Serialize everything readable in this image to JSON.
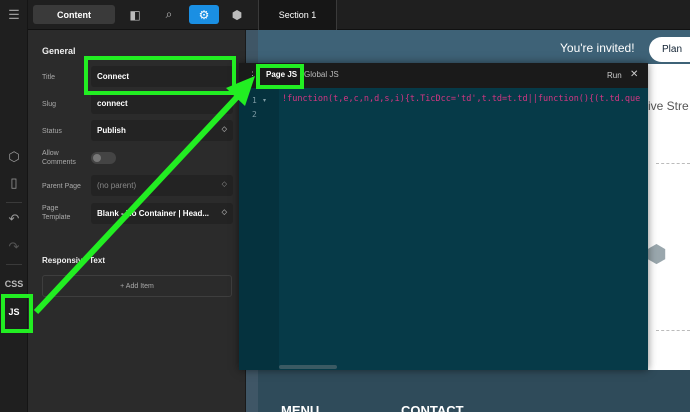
{
  "toolbar": {
    "content_tab": "Content",
    "section_tab": "Section 1"
  },
  "rail": {
    "css_label": "CSS",
    "js_label": "JS"
  },
  "panel": {
    "general_heading": "General",
    "title_label": "Title",
    "title_value": "Connect",
    "slug_label": "Slug",
    "slug_value": "connect",
    "status_label": "Status",
    "status_value": "Publish",
    "allow_comments_label_1": "Allow",
    "allow_comments_label_2": "Comments",
    "parent_page_label": "Parent Page",
    "parent_page_value": "(no parent)",
    "page_template_label_1": "Page",
    "page_template_label_2": "Template",
    "page_template_value": "Blank - No Container | Head...",
    "responsive_text_heading": "Responsive Text",
    "add_item_label": "+ Add Item"
  },
  "editor": {
    "page_js_tab": "Page JS",
    "global_js_tab": "Global JS",
    "run_label": "Run",
    "line_numbers": [
      "1",
      "2"
    ],
    "code_line_1": "!function(t,e,c,n,d,s,i){t.TicDcc='td',t.td=t.td||function(){(t.td.que"
  },
  "preview": {
    "invite_text": "You're invited!",
    "plan_button": "Plan",
    "stre_text": "ive Stre",
    "footer_menu": "MENU",
    "footer_contact": "CONTACT"
  },
  "colors": {
    "highlight": "#22ee22",
    "accent": "#1a8fe3",
    "editor_bg": "#063a48"
  }
}
